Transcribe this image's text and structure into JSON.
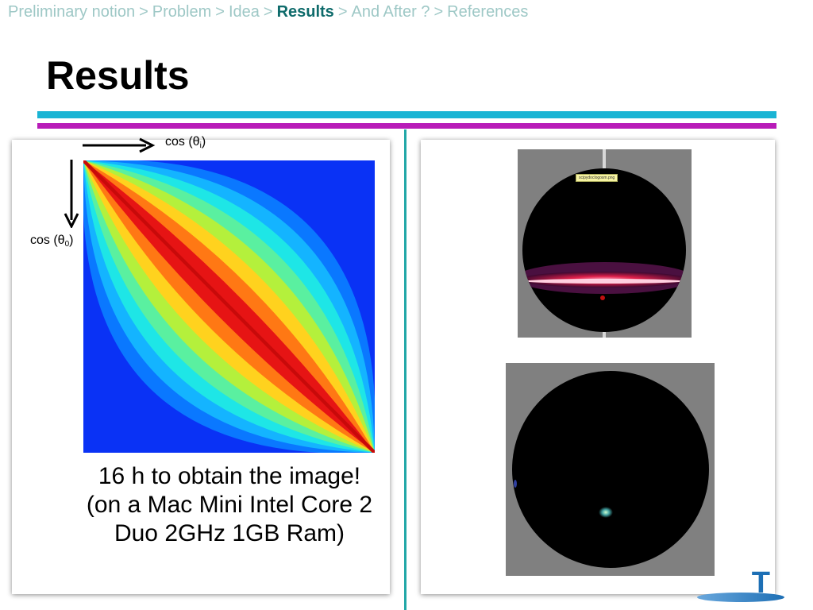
{
  "breadcrumb": {
    "items": [
      "Preliminary notion",
      "Problem",
      "Idea",
      "Results",
      "And After ?",
      "References"
    ],
    "separator": ">",
    "active": "Results"
  },
  "slide": {
    "title": "Results"
  },
  "left_panel": {
    "axis_top_label": "cos (θ",
    "axis_top_sub": "i",
    "axis_top_close": ")",
    "axis_left_label": "cos (θ",
    "axis_left_sub": "0",
    "axis_left_close": ")",
    "caption": "16 h to obtain the image! (on a Mac Mini Intel Core 2 Duo 2GHz 1GB Ram)",
    "heatmap_colors": [
      "#0a32f5",
      "#0a78ff",
      "#14b4ff",
      "#1ee6e6",
      "#5af0a0",
      "#b4f03c",
      "#ffd21e",
      "#ff7814",
      "#e61414"
    ]
  },
  "right_panel": {
    "image1_tag": "scipydoclogosm.png"
  },
  "logo": {
    "letter": "T"
  },
  "colors": {
    "breadcrumb": "#9ec8c6",
    "breadcrumb_active": "#0e6b6b",
    "rule_cyan": "#1ab4d4",
    "rule_magenta": "#b81cb8",
    "divider": "#22a7a7"
  }
}
